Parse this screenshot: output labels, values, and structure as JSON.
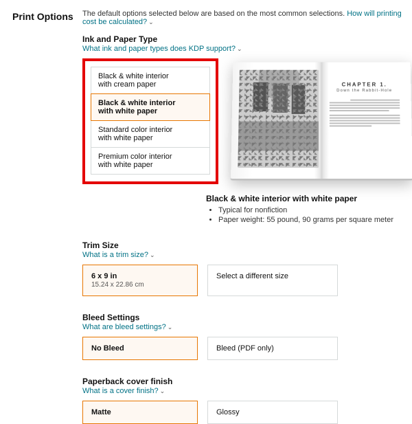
{
  "header": {
    "title": "Print Options",
    "intro_prefix": "The default options selected below are based on the most common selections. ",
    "intro_link": "How will printing cost be calculated?"
  },
  "ink": {
    "heading": "Ink and Paper Type",
    "help": "What ink and paper types does KDP support?",
    "options": [
      {
        "line1": "Black & white interior",
        "line2": "with cream paper"
      },
      {
        "line1": "Black & white interior",
        "line2": "with white paper"
      },
      {
        "line1": "Standard color interior",
        "line2": "with white paper"
      },
      {
        "line1": "Premium color interior",
        "line2": "with white paper"
      }
    ],
    "preview": {
      "chapter": "CHAPTER 1.",
      "subtitle": "Down the Rabbit-Hole"
    },
    "desc": {
      "title": "Black & white interior with white paper",
      "bullets": [
        "Typical for nonfiction",
        "Paper weight: 55 pound, 90 grams per square meter"
      ]
    }
  },
  "trim": {
    "heading": "Trim Size",
    "help": "What is a trim size?",
    "selected": {
      "line1": "6 x 9 in",
      "line2": "15.24 x 22.86 cm"
    },
    "other": "Select a different size"
  },
  "bleed": {
    "heading": "Bleed Settings",
    "help": "What are bleed settings?",
    "selected": "No Bleed",
    "other": "Bleed (PDF only)"
  },
  "cover": {
    "heading": "Paperback cover finish",
    "help": "What is a cover finish?",
    "selected": "Matte",
    "other": "Glossy"
  }
}
